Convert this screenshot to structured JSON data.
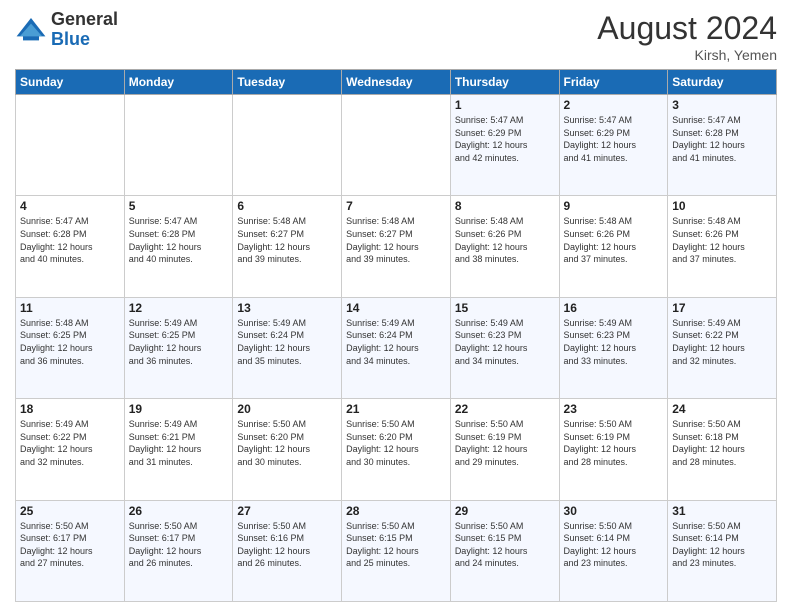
{
  "header": {
    "logo_line1": "General",
    "logo_line2": "Blue",
    "month_title": "August 2024",
    "location": "Kirsh, Yemen"
  },
  "days_of_week": [
    "Sunday",
    "Monday",
    "Tuesday",
    "Wednesday",
    "Thursday",
    "Friday",
    "Saturday"
  ],
  "weeks": [
    [
      {
        "day": "",
        "info": ""
      },
      {
        "day": "",
        "info": ""
      },
      {
        "day": "",
        "info": ""
      },
      {
        "day": "",
        "info": ""
      },
      {
        "day": "1",
        "info": "Sunrise: 5:47 AM\nSunset: 6:29 PM\nDaylight: 12 hours\nand 42 minutes."
      },
      {
        "day": "2",
        "info": "Sunrise: 5:47 AM\nSunset: 6:29 PM\nDaylight: 12 hours\nand 41 minutes."
      },
      {
        "day": "3",
        "info": "Sunrise: 5:47 AM\nSunset: 6:28 PM\nDaylight: 12 hours\nand 41 minutes."
      }
    ],
    [
      {
        "day": "4",
        "info": "Sunrise: 5:47 AM\nSunset: 6:28 PM\nDaylight: 12 hours\nand 40 minutes."
      },
      {
        "day": "5",
        "info": "Sunrise: 5:47 AM\nSunset: 6:28 PM\nDaylight: 12 hours\nand 40 minutes."
      },
      {
        "day": "6",
        "info": "Sunrise: 5:48 AM\nSunset: 6:27 PM\nDaylight: 12 hours\nand 39 minutes."
      },
      {
        "day": "7",
        "info": "Sunrise: 5:48 AM\nSunset: 6:27 PM\nDaylight: 12 hours\nand 39 minutes."
      },
      {
        "day": "8",
        "info": "Sunrise: 5:48 AM\nSunset: 6:26 PM\nDaylight: 12 hours\nand 38 minutes."
      },
      {
        "day": "9",
        "info": "Sunrise: 5:48 AM\nSunset: 6:26 PM\nDaylight: 12 hours\nand 37 minutes."
      },
      {
        "day": "10",
        "info": "Sunrise: 5:48 AM\nSunset: 6:26 PM\nDaylight: 12 hours\nand 37 minutes."
      }
    ],
    [
      {
        "day": "11",
        "info": "Sunrise: 5:48 AM\nSunset: 6:25 PM\nDaylight: 12 hours\nand 36 minutes."
      },
      {
        "day": "12",
        "info": "Sunrise: 5:49 AM\nSunset: 6:25 PM\nDaylight: 12 hours\nand 36 minutes."
      },
      {
        "day": "13",
        "info": "Sunrise: 5:49 AM\nSunset: 6:24 PM\nDaylight: 12 hours\nand 35 minutes."
      },
      {
        "day": "14",
        "info": "Sunrise: 5:49 AM\nSunset: 6:24 PM\nDaylight: 12 hours\nand 34 minutes."
      },
      {
        "day": "15",
        "info": "Sunrise: 5:49 AM\nSunset: 6:23 PM\nDaylight: 12 hours\nand 34 minutes."
      },
      {
        "day": "16",
        "info": "Sunrise: 5:49 AM\nSunset: 6:23 PM\nDaylight: 12 hours\nand 33 minutes."
      },
      {
        "day": "17",
        "info": "Sunrise: 5:49 AM\nSunset: 6:22 PM\nDaylight: 12 hours\nand 32 minutes."
      }
    ],
    [
      {
        "day": "18",
        "info": "Sunrise: 5:49 AM\nSunset: 6:22 PM\nDaylight: 12 hours\nand 32 minutes."
      },
      {
        "day": "19",
        "info": "Sunrise: 5:49 AM\nSunset: 6:21 PM\nDaylight: 12 hours\nand 31 minutes."
      },
      {
        "day": "20",
        "info": "Sunrise: 5:50 AM\nSunset: 6:20 PM\nDaylight: 12 hours\nand 30 minutes."
      },
      {
        "day": "21",
        "info": "Sunrise: 5:50 AM\nSunset: 6:20 PM\nDaylight: 12 hours\nand 30 minutes."
      },
      {
        "day": "22",
        "info": "Sunrise: 5:50 AM\nSunset: 6:19 PM\nDaylight: 12 hours\nand 29 minutes."
      },
      {
        "day": "23",
        "info": "Sunrise: 5:50 AM\nSunset: 6:19 PM\nDaylight: 12 hours\nand 28 minutes."
      },
      {
        "day": "24",
        "info": "Sunrise: 5:50 AM\nSunset: 6:18 PM\nDaylight: 12 hours\nand 28 minutes."
      }
    ],
    [
      {
        "day": "25",
        "info": "Sunrise: 5:50 AM\nSunset: 6:17 PM\nDaylight: 12 hours\nand 27 minutes."
      },
      {
        "day": "26",
        "info": "Sunrise: 5:50 AM\nSunset: 6:17 PM\nDaylight: 12 hours\nand 26 minutes."
      },
      {
        "day": "27",
        "info": "Sunrise: 5:50 AM\nSunset: 6:16 PM\nDaylight: 12 hours\nand 26 minutes."
      },
      {
        "day": "28",
        "info": "Sunrise: 5:50 AM\nSunset: 6:15 PM\nDaylight: 12 hours\nand 25 minutes."
      },
      {
        "day": "29",
        "info": "Sunrise: 5:50 AM\nSunset: 6:15 PM\nDaylight: 12 hours\nand 24 minutes."
      },
      {
        "day": "30",
        "info": "Sunrise: 5:50 AM\nSunset: 6:14 PM\nDaylight: 12 hours\nand 23 minutes."
      },
      {
        "day": "31",
        "info": "Sunrise: 5:50 AM\nSunset: 6:14 PM\nDaylight: 12 hours\nand 23 minutes."
      }
    ]
  ]
}
